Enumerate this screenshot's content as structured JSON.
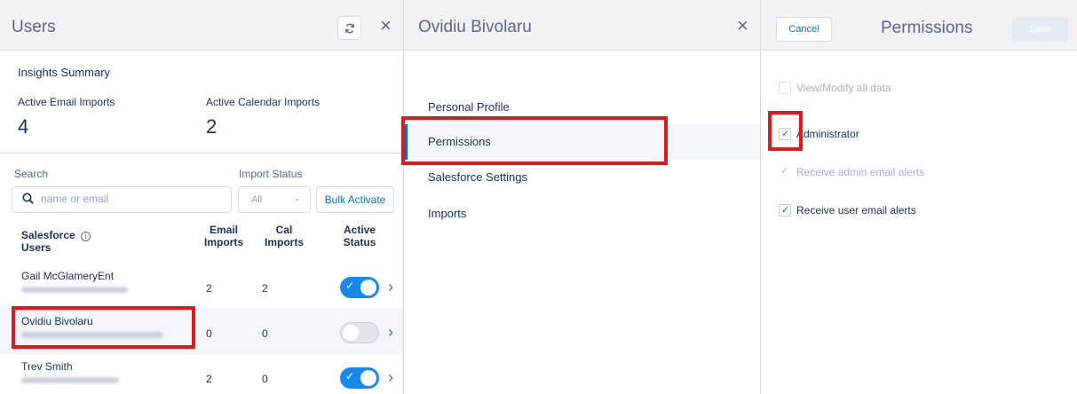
{
  "users_panel": {
    "title": "Users",
    "insights_title": "Insights Summary",
    "email_imports_label": "Active Email Imports",
    "email_imports_value": "4",
    "calendar_imports_label": "Active Calendar Imports",
    "calendar_imports_value": "2",
    "search_label": "Search",
    "search_placeholder": "name or email",
    "import_status_label": "Import Status",
    "import_status_value": "All",
    "bulk_activate_label": "Bulk Activate",
    "columns": {
      "users_line1": "Salesforce",
      "users_line2": "Users",
      "email_line1": "Email",
      "email_line2": "Imports",
      "cal_line1": "Cal",
      "cal_line2": "Imports",
      "active_line1": "Active",
      "active_line2": "Status"
    },
    "rows": [
      {
        "name": "Gail McGlameryEnt",
        "email_imports": "2",
        "cal_imports": "2",
        "active": true
      },
      {
        "name": "Ovidiu Bivolaru",
        "email_imports": "0",
        "cal_imports": "0",
        "active": false
      },
      {
        "name": "Trev Smith",
        "email_imports": "2",
        "cal_imports": "0",
        "active": true
      }
    ]
  },
  "detail_panel": {
    "title": "Ovidiu Bivolaru",
    "nav": [
      {
        "label": "Personal Profile"
      },
      {
        "label": "Permissions"
      },
      {
        "label": "Salesforce Settings"
      },
      {
        "label": "Imports"
      }
    ]
  },
  "permissions_panel": {
    "title": "Permissions",
    "cancel_label": "Cancel",
    "save_label": "Save",
    "options": [
      {
        "label": "View/Modify all data",
        "checked": false,
        "disabled": true
      },
      {
        "label": "Administrator",
        "checked": true,
        "disabled": false
      },
      {
        "label": "Receive admin email alerts",
        "checked": true,
        "disabled": true
      },
      {
        "label": "Receive user email alerts",
        "checked": true,
        "disabled": false
      }
    ]
  },
  "colors": {
    "accent": "#0070d2",
    "toggle_on": "#1589ee",
    "highlight_border": "#e01a1a",
    "header_bg": "#f3f2f2"
  }
}
